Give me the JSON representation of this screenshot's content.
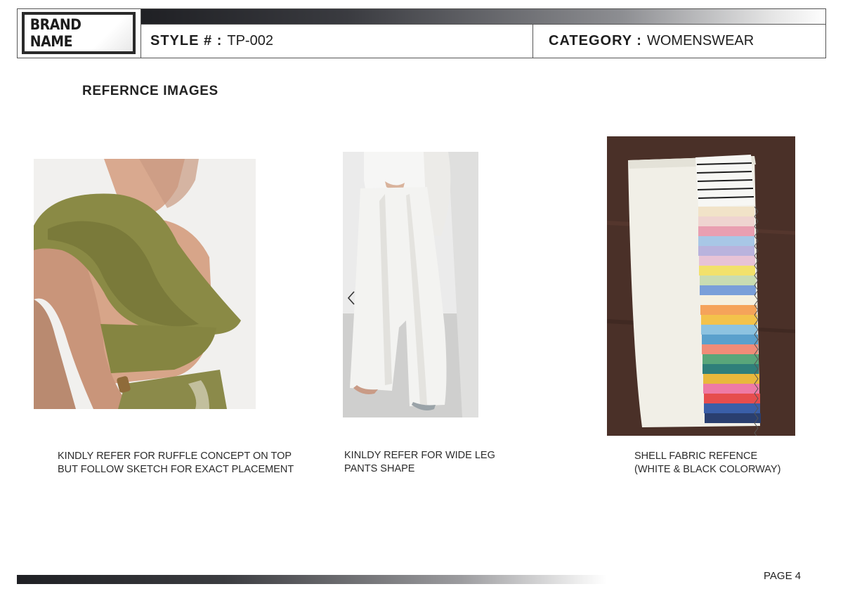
{
  "header": {
    "brand_name": "BRAND NAME",
    "style_label": "STYLE # :",
    "style_value": "TP-002",
    "category_label": "CATEGORY :",
    "category_value": "WOMENSWEAR"
  },
  "section_title": "REFERNCE IMAGES",
  "references": [
    {
      "image": "olive-ruffle-one-shoulder-top-photo",
      "caption_lines": [
        "KINDLY REFER FOR RUFFLE CONCEPT ON TOP",
        "BUT FOLLOW SKETCH FOR EXACT PLACEMENT"
      ]
    },
    {
      "image": "white-wide-leg-pants-photo",
      "caption_lines": [
        "KINLDY REFER FOR WIDE LEG",
        "PANTS SHAPE"
      ]
    },
    {
      "image": "multicolor-fabric-swatch-photo",
      "caption_lines": [
        "SHELL FABRIC REFENCE",
        "(WHITE & BLACK COLORWAY)"
      ]
    }
  ],
  "footer": {
    "page": "PAGE 4"
  },
  "colors": {
    "header_bar": "#1f2024",
    "border": "#555555",
    "text": "#222222"
  },
  "icons": {
    "carousel_prev": "chevron-left-icon"
  }
}
